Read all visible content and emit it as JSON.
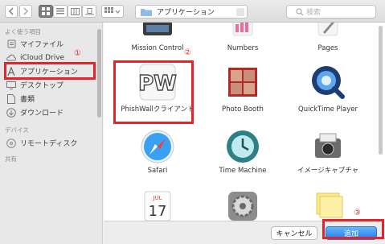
{
  "toolbar": {
    "location": "アプリケーション",
    "search_placeholder": "検索"
  },
  "sidebar": {
    "section_favorites": "よく使う項目",
    "items": [
      {
        "label": "マイファイル"
      },
      {
        "label": "iCloud Drive"
      },
      {
        "label": "アプリケーション"
      },
      {
        "label": "デスクトップ"
      },
      {
        "label": "書類"
      },
      {
        "label": "ダウンロード"
      }
    ],
    "section_devices": "デバイス",
    "devices": [
      {
        "label": "リモートディスク"
      }
    ],
    "section_shared": "共有"
  },
  "apps": [
    {
      "label": "Mission Control"
    },
    {
      "label": "Numbers"
    },
    {
      "label": "Pages"
    },
    {
      "label": "PhishWallクライアント",
      "icon_text": "PW"
    },
    {
      "label": "Photo Booth"
    },
    {
      "label": "QuickTime Player"
    },
    {
      "label": "Safari"
    },
    {
      "label": "Time Machine"
    },
    {
      "label": "イメージキャプチャ"
    },
    {
      "label": "",
      "cal_month": "JUL",
      "cal_day": "17"
    },
    {
      "label": ""
    },
    {
      "label": ""
    }
  ],
  "footer": {
    "cancel_label": "キャンセル",
    "add_label": "追加"
  },
  "annotations": {
    "n1": "①",
    "n2": "②",
    "n3": "③",
    "color": "#e5232b"
  }
}
